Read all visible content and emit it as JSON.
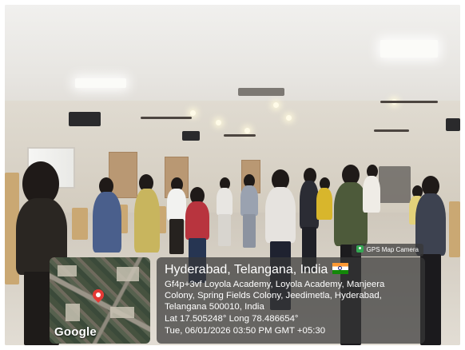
{
  "overlay": {
    "brand": "GPS Map Camera",
    "title": "Hyderabad, Telangana, India",
    "address_lines": [
      "Gf4p+3vf Loyola Academy, Loyola Academy, Manjeera",
      "Colony, Spring Fields Colony, Jeedimetla, Hyderabad,",
      "Telangana 500010, India"
    ],
    "coordinates": "Lat 17.505248° Long 78.486654°",
    "datetime": "Tue, 06/01/2026 03:50 PM GMT +05:30",
    "map_label": "Google"
  },
  "icons": {
    "flag": "india-flag-icon",
    "pin": "map-pin-icon",
    "brand": "gps-map-camera-icon"
  },
  "colors": {
    "overlay_bg": "#373737",
    "pin": "#e53935"
  }
}
